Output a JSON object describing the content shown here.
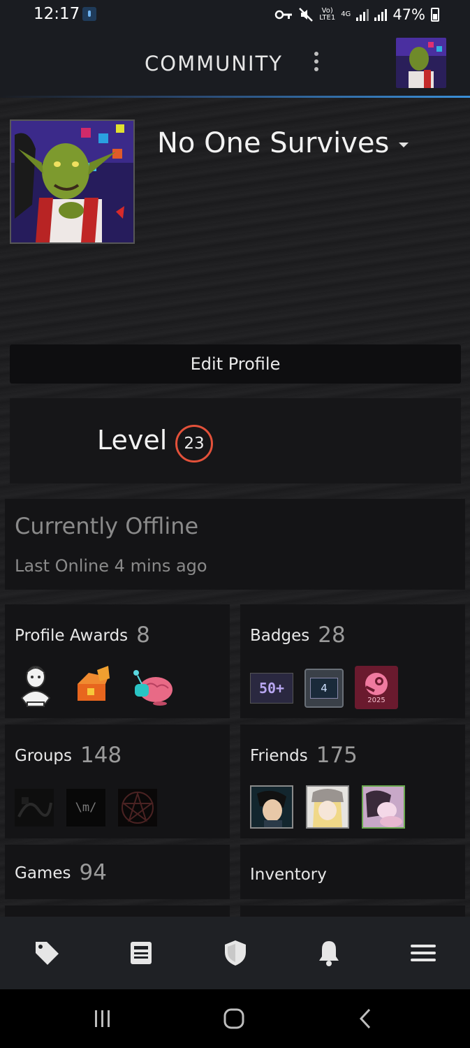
{
  "status_bar": {
    "time": "12:17",
    "network_top": "Vo)",
    "network_bottom": "LTE1",
    "network_type": "4G",
    "battery": "47%"
  },
  "header": {
    "title": "COMMUNITY",
    "accent_color": "#3a8fd8"
  },
  "profile": {
    "persona_name": "No One Survives",
    "edit_button": "Edit Profile",
    "level_label": "Level",
    "level_value": "23",
    "level_color": "#e3513a",
    "status": "Currently Offline",
    "last_online": "Last Online 4 mins ago"
  },
  "cards": {
    "awards": {
      "label": "Profile Awards",
      "count": "8"
    },
    "badges": {
      "label": "Badges",
      "count": "28",
      "items": [
        "50+",
        "4",
        "2025"
      ]
    },
    "groups": {
      "label": "Groups",
      "count": "148",
      "items": [
        "",
        "\\m/",
        ""
      ]
    },
    "friends": {
      "label": "Friends",
      "count": "175"
    },
    "games": {
      "label": "Games",
      "count": "94"
    },
    "inventory": {
      "label": "Inventory"
    }
  },
  "bottom_nav": [
    "tag-icon",
    "news-icon",
    "shield-icon",
    "bell-icon",
    "menu-icon"
  ],
  "system_nav": [
    "recent-apps-icon",
    "home-icon",
    "back-icon"
  ]
}
